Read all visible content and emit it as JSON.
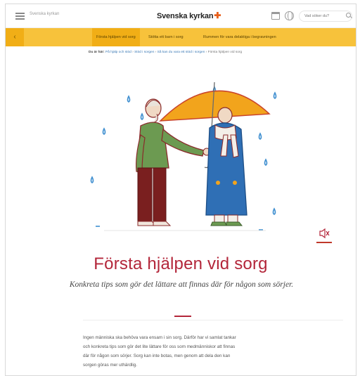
{
  "header": {
    "site_name": "Svenska kyrkan",
    "logo_text": "Svenska kyrkan",
    "search_placeholder": "Vad söker du?"
  },
  "nav": {
    "items": [
      {
        "label": "Första hjälpen vid sorg",
        "active": true
      },
      {
        "label": "Stötta ett barn i sorg",
        "active": false
      },
      {
        "label": "Rummen för vara delaktiga i begravningen",
        "active": false
      }
    ]
  },
  "breadcrumb": {
    "prefix": "Du är här:",
    "items": [
      "På hjälp och stöd",
      "Stöd i sorgen",
      "Så kan du vara ett stöd i sorgen",
      "Första hjälpen vid sorg"
    ]
  },
  "hero": {
    "sound_icon": "speaker-icon"
  },
  "article": {
    "title": "Första hjälpen vid sorg",
    "subtitle": "Konkreta tips som gör det lättare att finnas där för någon som sörjer.",
    "body": [
      "Ingen människa ska behöva vara ensam i sin sorg. Därför har vi samlat tankar",
      "och konkreta tips som gör det lite lättare för oss som medmänniskor att finnas",
      "där för någon som sörjer. Sorg kan inte botas, men genom att dela den kan",
      "sorgen göras mer uthärdlig."
    ]
  },
  "colors": {
    "accent_red": "#b3263a",
    "nav_yellow": "#f7c23b",
    "umbrella": "#f2a41c",
    "rain": "#3f8fd0"
  }
}
